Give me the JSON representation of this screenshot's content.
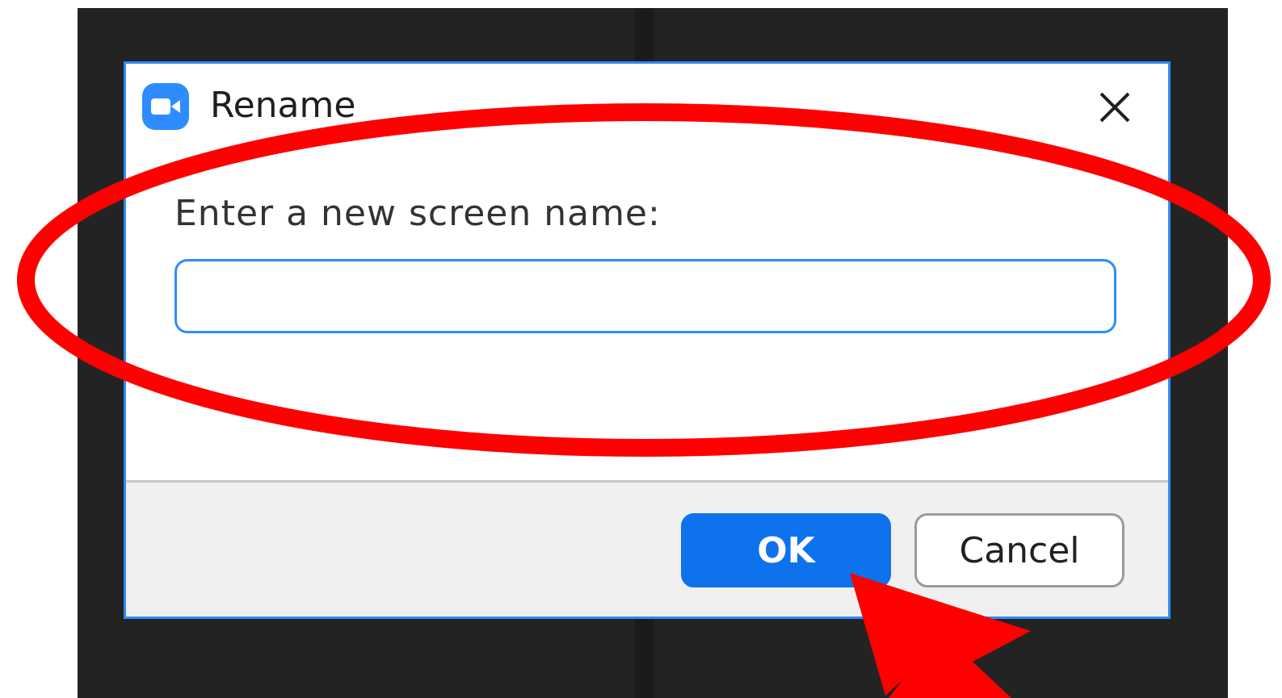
{
  "dialog": {
    "title": "Rename",
    "app_icon": "video-camera-icon",
    "close_icon": "close-icon"
  },
  "form": {
    "prompt": "Enter a new screen name:",
    "input_value": "",
    "input_placeholder": ""
  },
  "buttons": {
    "ok_label": "OK",
    "cancel_label": "Cancel"
  },
  "annotation": {
    "highlight_shape": "ellipse",
    "pointer_shape": "arrow",
    "color": "#ff0000"
  },
  "colors": {
    "accent": "#2d8cff",
    "ok_button": "#0e72ed",
    "backdrop": "#232323",
    "footer": "#f0f0f0"
  }
}
